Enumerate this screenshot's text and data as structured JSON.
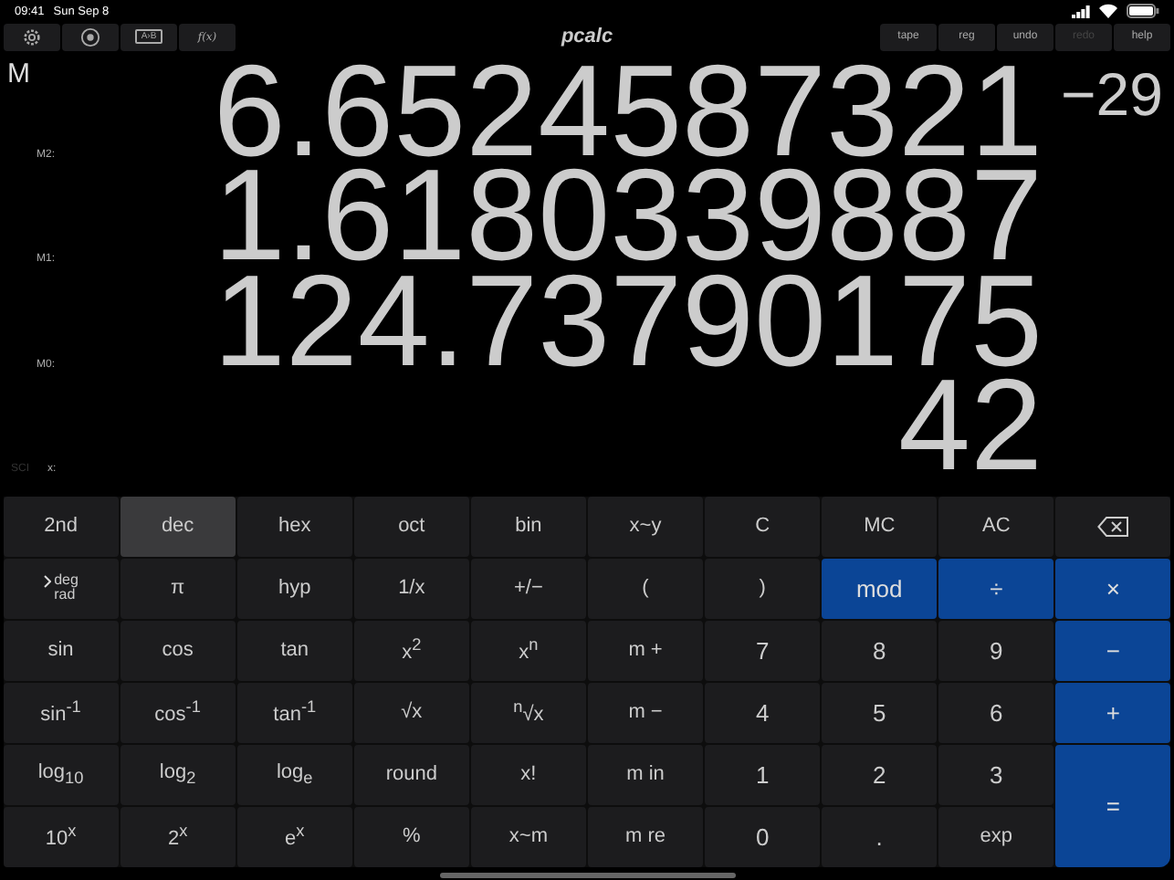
{
  "status_bar": {
    "time": "09:41",
    "date": "Sun Sep 8"
  },
  "toolbar": {
    "left": [
      {
        "kind": "gear"
      },
      {
        "kind": "coin"
      },
      {
        "kind": "swap",
        "label": "A›B"
      },
      {
        "kind": "text",
        "label": "f(x)"
      }
    ],
    "title": "pcalc",
    "right": [
      {
        "label": "tape",
        "disabled": false
      },
      {
        "label": "reg",
        "disabled": false
      },
      {
        "label": "undo",
        "disabled": false
      },
      {
        "label": "redo",
        "disabled": true
      },
      {
        "label": "help",
        "disabled": false
      }
    ]
  },
  "display": {
    "memory_indicator": "M",
    "mode": "SCI",
    "lines": [
      {
        "label": "M2:",
        "value": "6.6524587321",
        "exponent": "−29"
      },
      {
        "label": "M1:",
        "value": "1.6180339887"
      },
      {
        "label": "M0:",
        "value": "124.73790175"
      },
      {
        "label": "x:",
        "value": "42"
      }
    ]
  },
  "keys": [
    {
      "label": "2nd",
      "kind": "func"
    },
    {
      "label": "dec",
      "kind": "radix",
      "selected": true
    },
    {
      "label": "hex",
      "kind": "radix",
      "selected": false
    },
    {
      "label": "oct",
      "kind": "radix",
      "selected": false
    },
    {
      "label": "bin",
      "kind": "radix",
      "selected": false
    },
    {
      "label": "x~y",
      "kind": "func"
    },
    {
      "label": "C",
      "kind": "func"
    },
    {
      "label": "MC",
      "kind": "func"
    },
    {
      "label": "AC",
      "kind": "func"
    },
    {
      "kind": "backspace"
    },
    {
      "kind": "angle",
      "options": [
        {
          "label": "deg",
          "selected": true
        },
        {
          "label": "rad",
          "selected": false
        }
      ]
    },
    {
      "label": "π",
      "kind": "func"
    },
    {
      "label": "hyp",
      "kind": "func"
    },
    {
      "label": "1/x",
      "kind": "func"
    },
    {
      "label": "+/−",
      "kind": "func"
    },
    {
      "label": "(",
      "kind": "func"
    },
    {
      "label": ")",
      "kind": "func"
    },
    {
      "label": "mod",
      "kind": "op"
    },
    {
      "label": "÷",
      "kind": "op"
    },
    {
      "label": "×",
      "kind": "op"
    },
    {
      "label": "sin",
      "kind": "func"
    },
    {
      "label": "cos",
      "kind": "func"
    },
    {
      "label": "tan",
      "kind": "func"
    },
    {
      "label": "x$^{2}$",
      "kind": "func"
    },
    {
      "label": "x$^{n}$",
      "kind": "func"
    },
    {
      "label": "m +",
      "kind": "func"
    },
    {
      "label": "7",
      "kind": "digit"
    },
    {
      "label": "8",
      "kind": "digit"
    },
    {
      "label": "9",
      "kind": "digit"
    },
    {
      "label": "−",
      "kind": "op"
    },
    {
      "label": "sin$^{-1}$",
      "kind": "func"
    },
    {
      "label": "cos$^{-1}$",
      "kind": "func"
    },
    {
      "label": "tan$^{-1}$",
      "kind": "func"
    },
    {
      "label": "√x",
      "kind": "func"
    },
    {
      "label": "$^{n}$√x",
      "kind": "func"
    },
    {
      "label": "m −",
      "kind": "func"
    },
    {
      "label": "4",
      "kind": "digit"
    },
    {
      "label": "5",
      "kind": "digit"
    },
    {
      "label": "6",
      "kind": "digit"
    },
    {
      "label": "+",
      "kind": "op"
    },
    {
      "label": "log$_{10}$",
      "kind": "func"
    },
    {
      "label": "log$_{2}$",
      "kind": "func"
    },
    {
      "label": "log$_{e}$",
      "kind": "func"
    },
    {
      "label": "round",
      "kind": "func"
    },
    {
      "label": "x!",
      "kind": "func"
    },
    {
      "label": "m in",
      "kind": "func"
    },
    {
      "label": "1",
      "kind": "digit"
    },
    {
      "label": "2",
      "kind": "digit"
    },
    {
      "label": "3",
      "kind": "digit"
    },
    {
      "label": "=",
      "kind": "equals"
    },
    {
      "label": "10$^{x}$",
      "kind": "func"
    },
    {
      "label": "2$^{x}$",
      "kind": "func"
    },
    {
      "label": "e$^{x}$",
      "kind": "func"
    },
    {
      "label": "%",
      "kind": "func"
    },
    {
      "label": "x~m",
      "kind": "func"
    },
    {
      "label": "m re",
      "kind": "func"
    },
    {
      "label": "0",
      "kind": "digit"
    },
    {
      "label": ".",
      "kind": "digit"
    },
    {
      "label": "exp",
      "kind": "func"
    }
  ]
}
